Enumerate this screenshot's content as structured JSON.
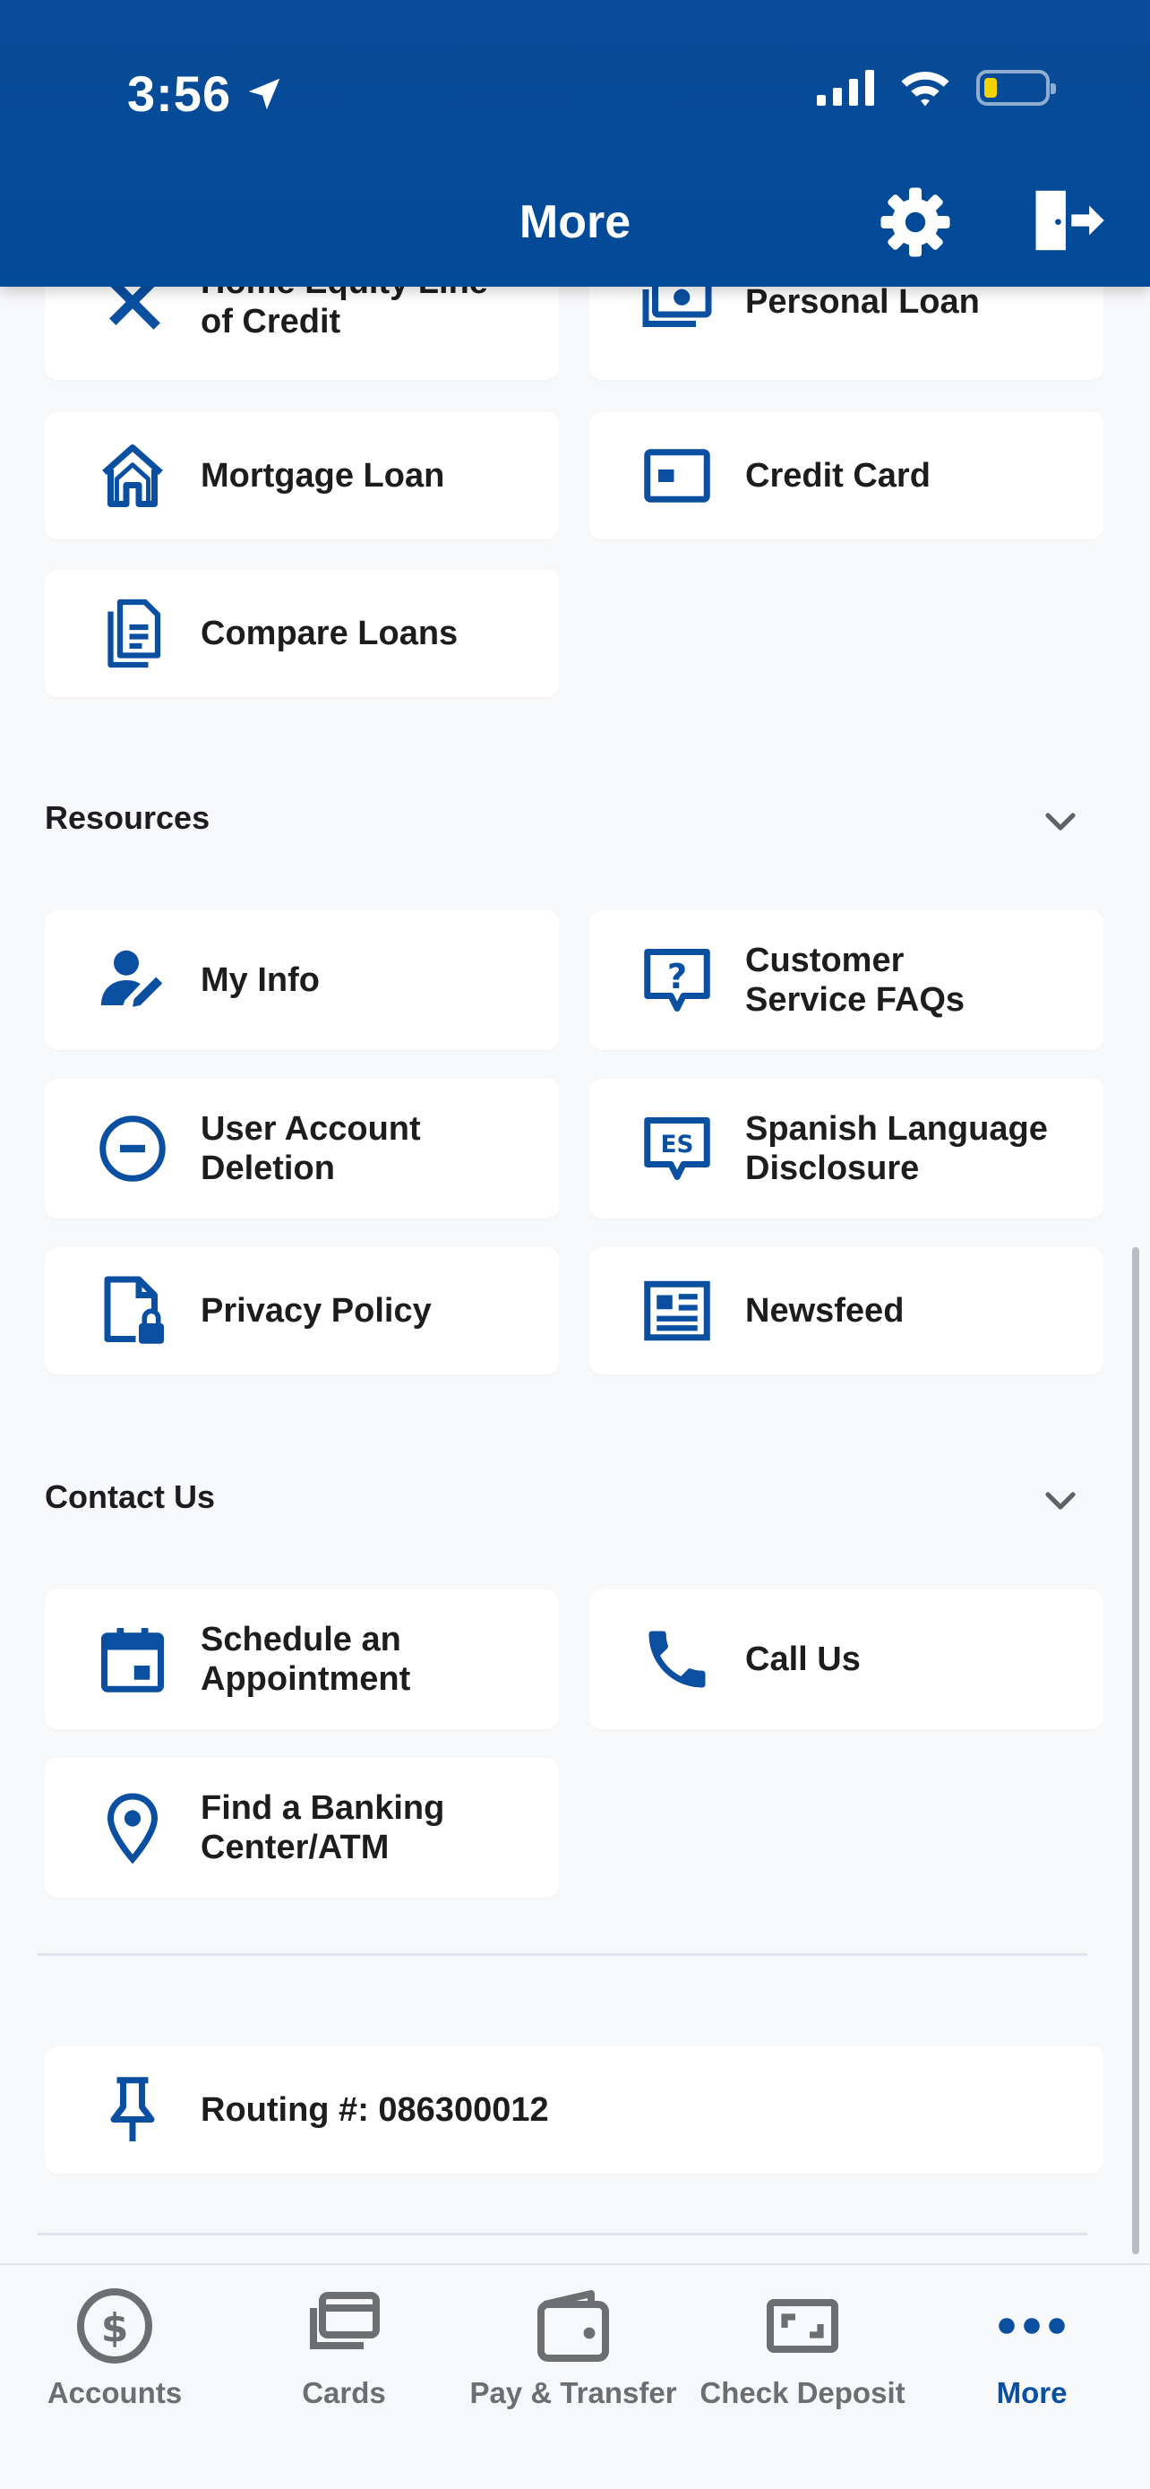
{
  "status_bar": {
    "time": "3:56"
  },
  "header": {
    "title": "More"
  },
  "loans": {
    "items": [
      {
        "label": "Home Equity Line\nof Credit",
        "icon": "hammer-wrench-icon"
      },
      {
        "label": "Personal Loan",
        "icon": "cash-icon"
      },
      {
        "label": "Mortgage Loan",
        "icon": "house-icon"
      },
      {
        "label": "Credit Card",
        "icon": "credit-card-icon"
      },
      {
        "label": "Compare Loans",
        "icon": "documents-icon"
      }
    ]
  },
  "resources": {
    "title": "Resources",
    "items": [
      {
        "label": "My Info",
        "icon": "user-edit-icon"
      },
      {
        "label": "Customer\nService FAQs",
        "icon": "question-bubble-icon"
      },
      {
        "label": "User Account\nDeletion",
        "icon": "minus-circle-icon"
      },
      {
        "label": "Spanish Language\nDisclosure",
        "icon": "es-bubble-icon"
      },
      {
        "label": "Privacy Policy",
        "icon": "file-lock-icon"
      },
      {
        "label": "Newsfeed",
        "icon": "newspaper-icon"
      }
    ]
  },
  "contact": {
    "title": "Contact Us",
    "items": [
      {
        "label": "Schedule an\nAppointment",
        "icon": "calendar-icon"
      },
      {
        "label": "Call Us",
        "icon": "phone-icon"
      },
      {
        "label": "Find a Banking\nCenter/ATM",
        "icon": "location-pin-icon"
      }
    ]
  },
  "routing": {
    "label": "Routing #: 086300012",
    "icon": "pushpin-icon"
  },
  "tabbar": {
    "tabs": [
      {
        "label": "Accounts",
        "icon": "dollar-circle-icon"
      },
      {
        "label": "Cards",
        "icon": "cards-icon"
      },
      {
        "label": "Pay & Transfer",
        "icon": "wallet-icon"
      },
      {
        "label": "Check Deposit",
        "icon": "check-scan-icon"
      },
      {
        "label": "More",
        "icon": "more-dots-icon"
      }
    ],
    "active_index": 4
  },
  "colors": {
    "brand_blue": "#014a97",
    "icon_blue": "#0b4fa1",
    "inactive_gray": "#6b6e73"
  }
}
